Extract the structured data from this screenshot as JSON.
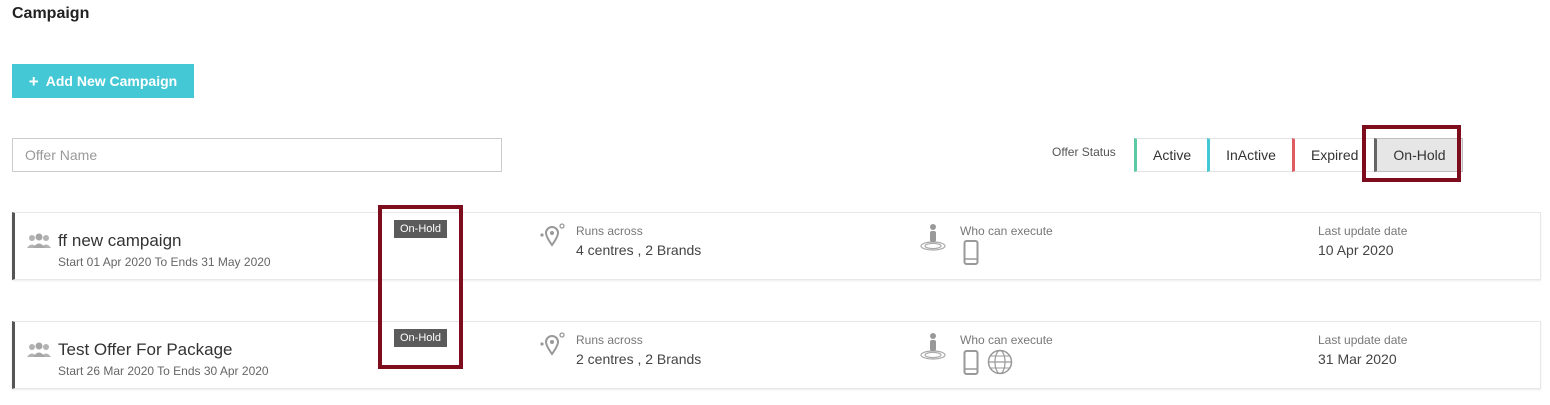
{
  "page": {
    "title": "Campaign"
  },
  "toolbar": {
    "add_label": "Add New Campaign"
  },
  "search": {
    "placeholder": "Offer Name",
    "value": ""
  },
  "status_filter": {
    "label": "Offer Status",
    "options": [
      {
        "label": "Active",
        "color": "#5cc9a7"
      },
      {
        "label": "InActive",
        "color": "#45c8d5"
      },
      {
        "label": "Expired",
        "color": "#e05c65"
      },
      {
        "label": "On-Hold",
        "color": "#666666",
        "selected": true
      }
    ]
  },
  "campaigns": [
    {
      "name": "ff new campaign",
      "dates": "Start 01 Apr 2020 To Ends 31 May 2020",
      "status": "On-Hold",
      "runs_label": "Runs across",
      "runs_value": "4 centres , 2 Brands",
      "who_label": "Who can execute",
      "executors": [
        "mobile-icon"
      ],
      "update_label": "Last update date",
      "update_value": "10 Apr 2020"
    },
    {
      "name": "Test Offer For Package",
      "dates": "Start 26 Mar 2020 To Ends 30 Apr 2020",
      "status": "On-Hold",
      "runs_label": "Runs across",
      "runs_value": "2 centres , 2 Brands",
      "who_label": "Who can execute",
      "executors": [
        "mobile-icon",
        "globe-icon"
      ],
      "update_label": "Last update date",
      "update_value": "31 Mar 2020"
    }
  ],
  "colors": {
    "accent": "#45c8d5",
    "highlight": "#7d0c1d",
    "badge": "#5b5b5b"
  }
}
